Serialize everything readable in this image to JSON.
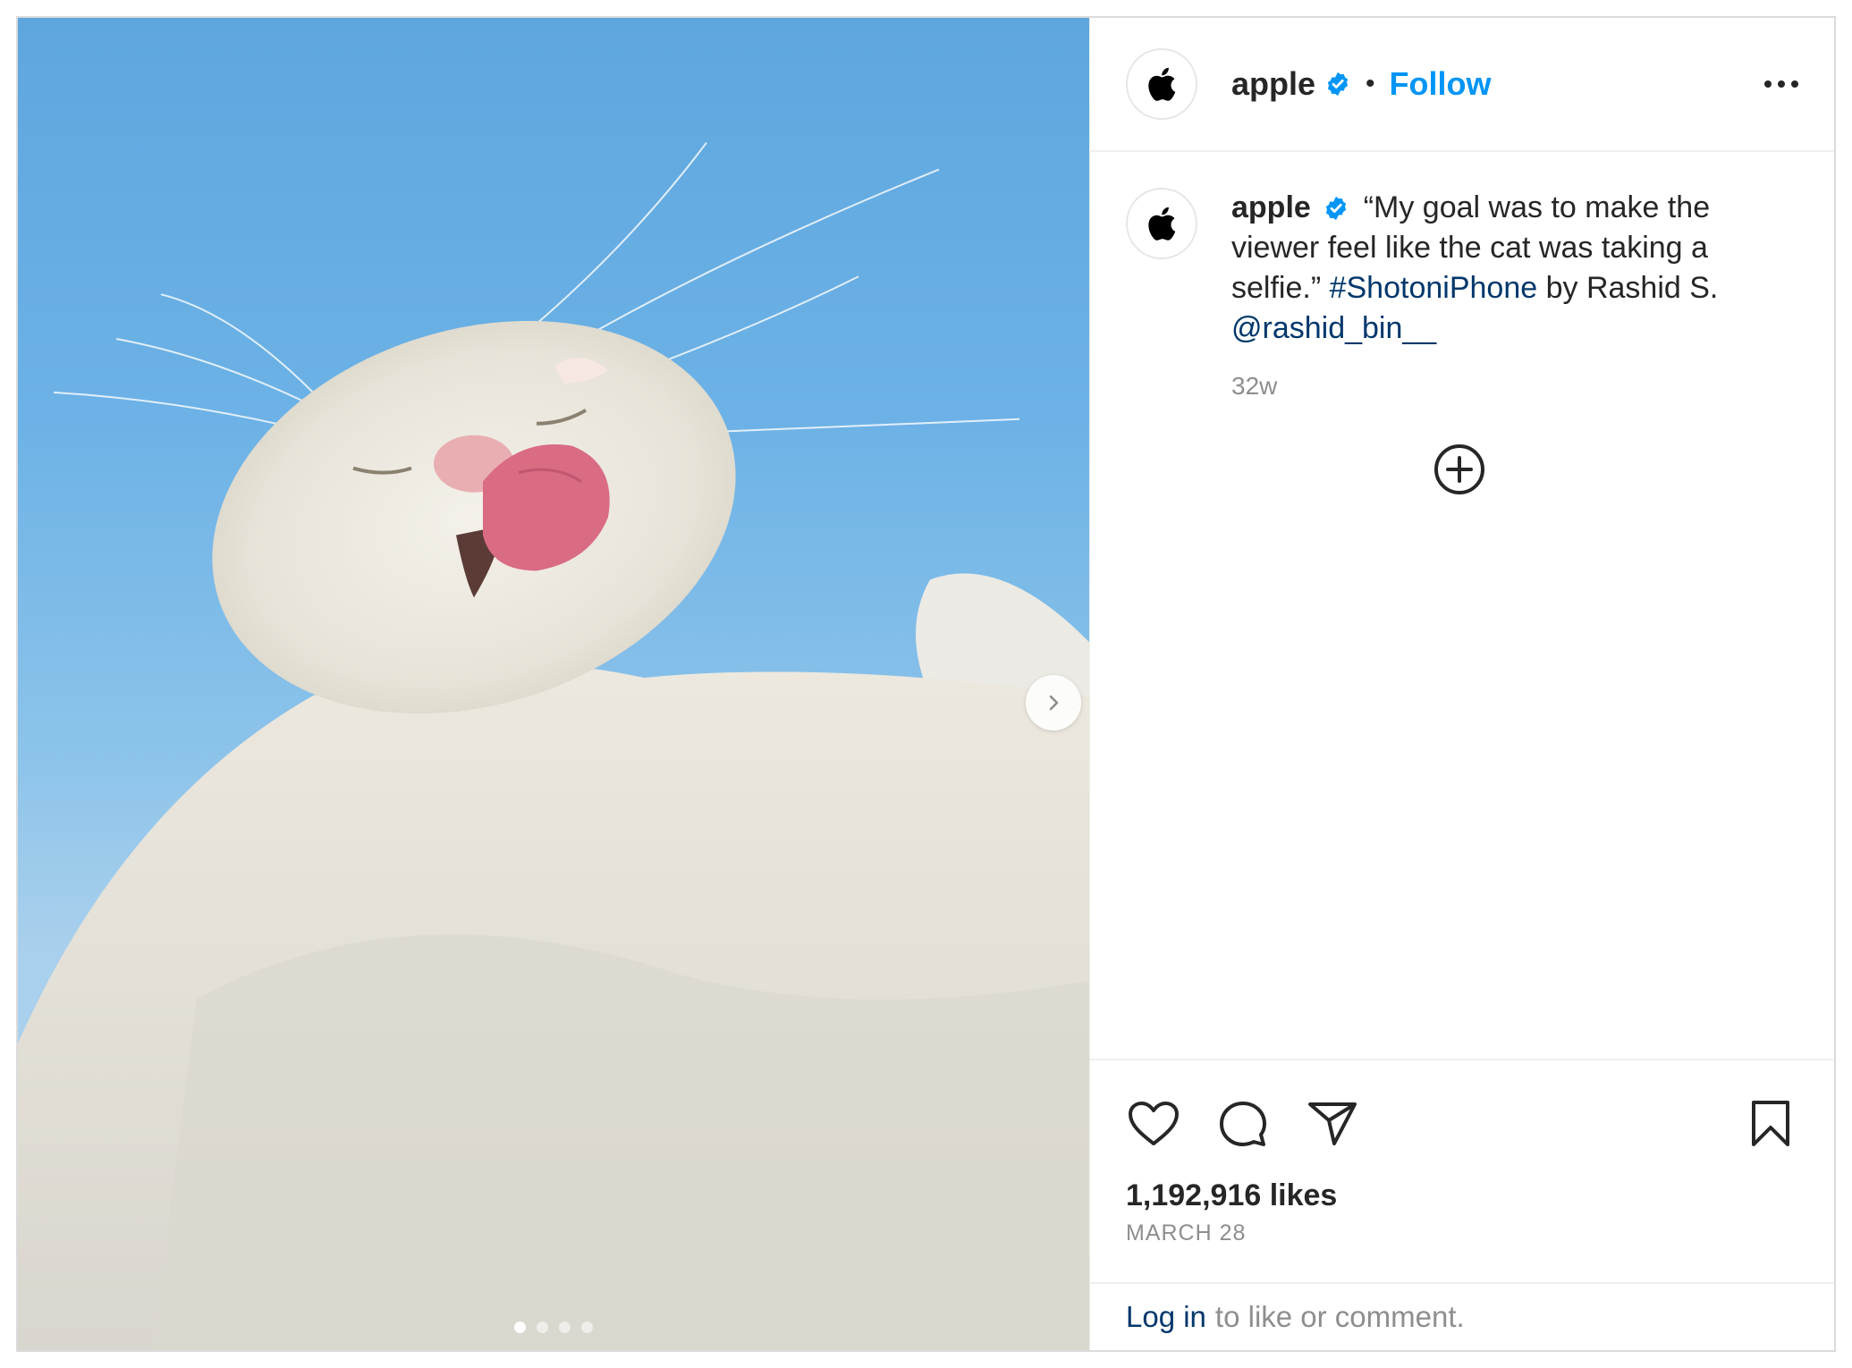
{
  "post": {
    "username": "apple",
    "follow_label": "Follow",
    "separator": "•",
    "caption": {
      "username": "apple",
      "text_before": "“My goal was to make the viewer feel like the cat was taking a selfie.” ",
      "hashtag": "#ShotoniPhone",
      "text_middle": " by Rashid S.",
      "mention": "@rashid_bin__"
    },
    "time_ago": "32w",
    "likes": "1,192,916 likes",
    "date": "MARCH 28",
    "login_link": "Log in",
    "login_text": "to like or comment."
  },
  "carousel": {
    "slides": 4,
    "active_index": 0
  },
  "colors": {
    "accent": "#0095f6",
    "link": "#00376b",
    "muted": "#8e8e8e",
    "text": "#262626",
    "sky": "#6cb2e6"
  },
  "icons": [
    "apple-logo-icon",
    "verified-badge-icon",
    "more-options-icon",
    "chevron-right-icon",
    "plus-circle-icon",
    "heart-icon",
    "comment-icon",
    "share-icon",
    "bookmark-icon"
  ]
}
